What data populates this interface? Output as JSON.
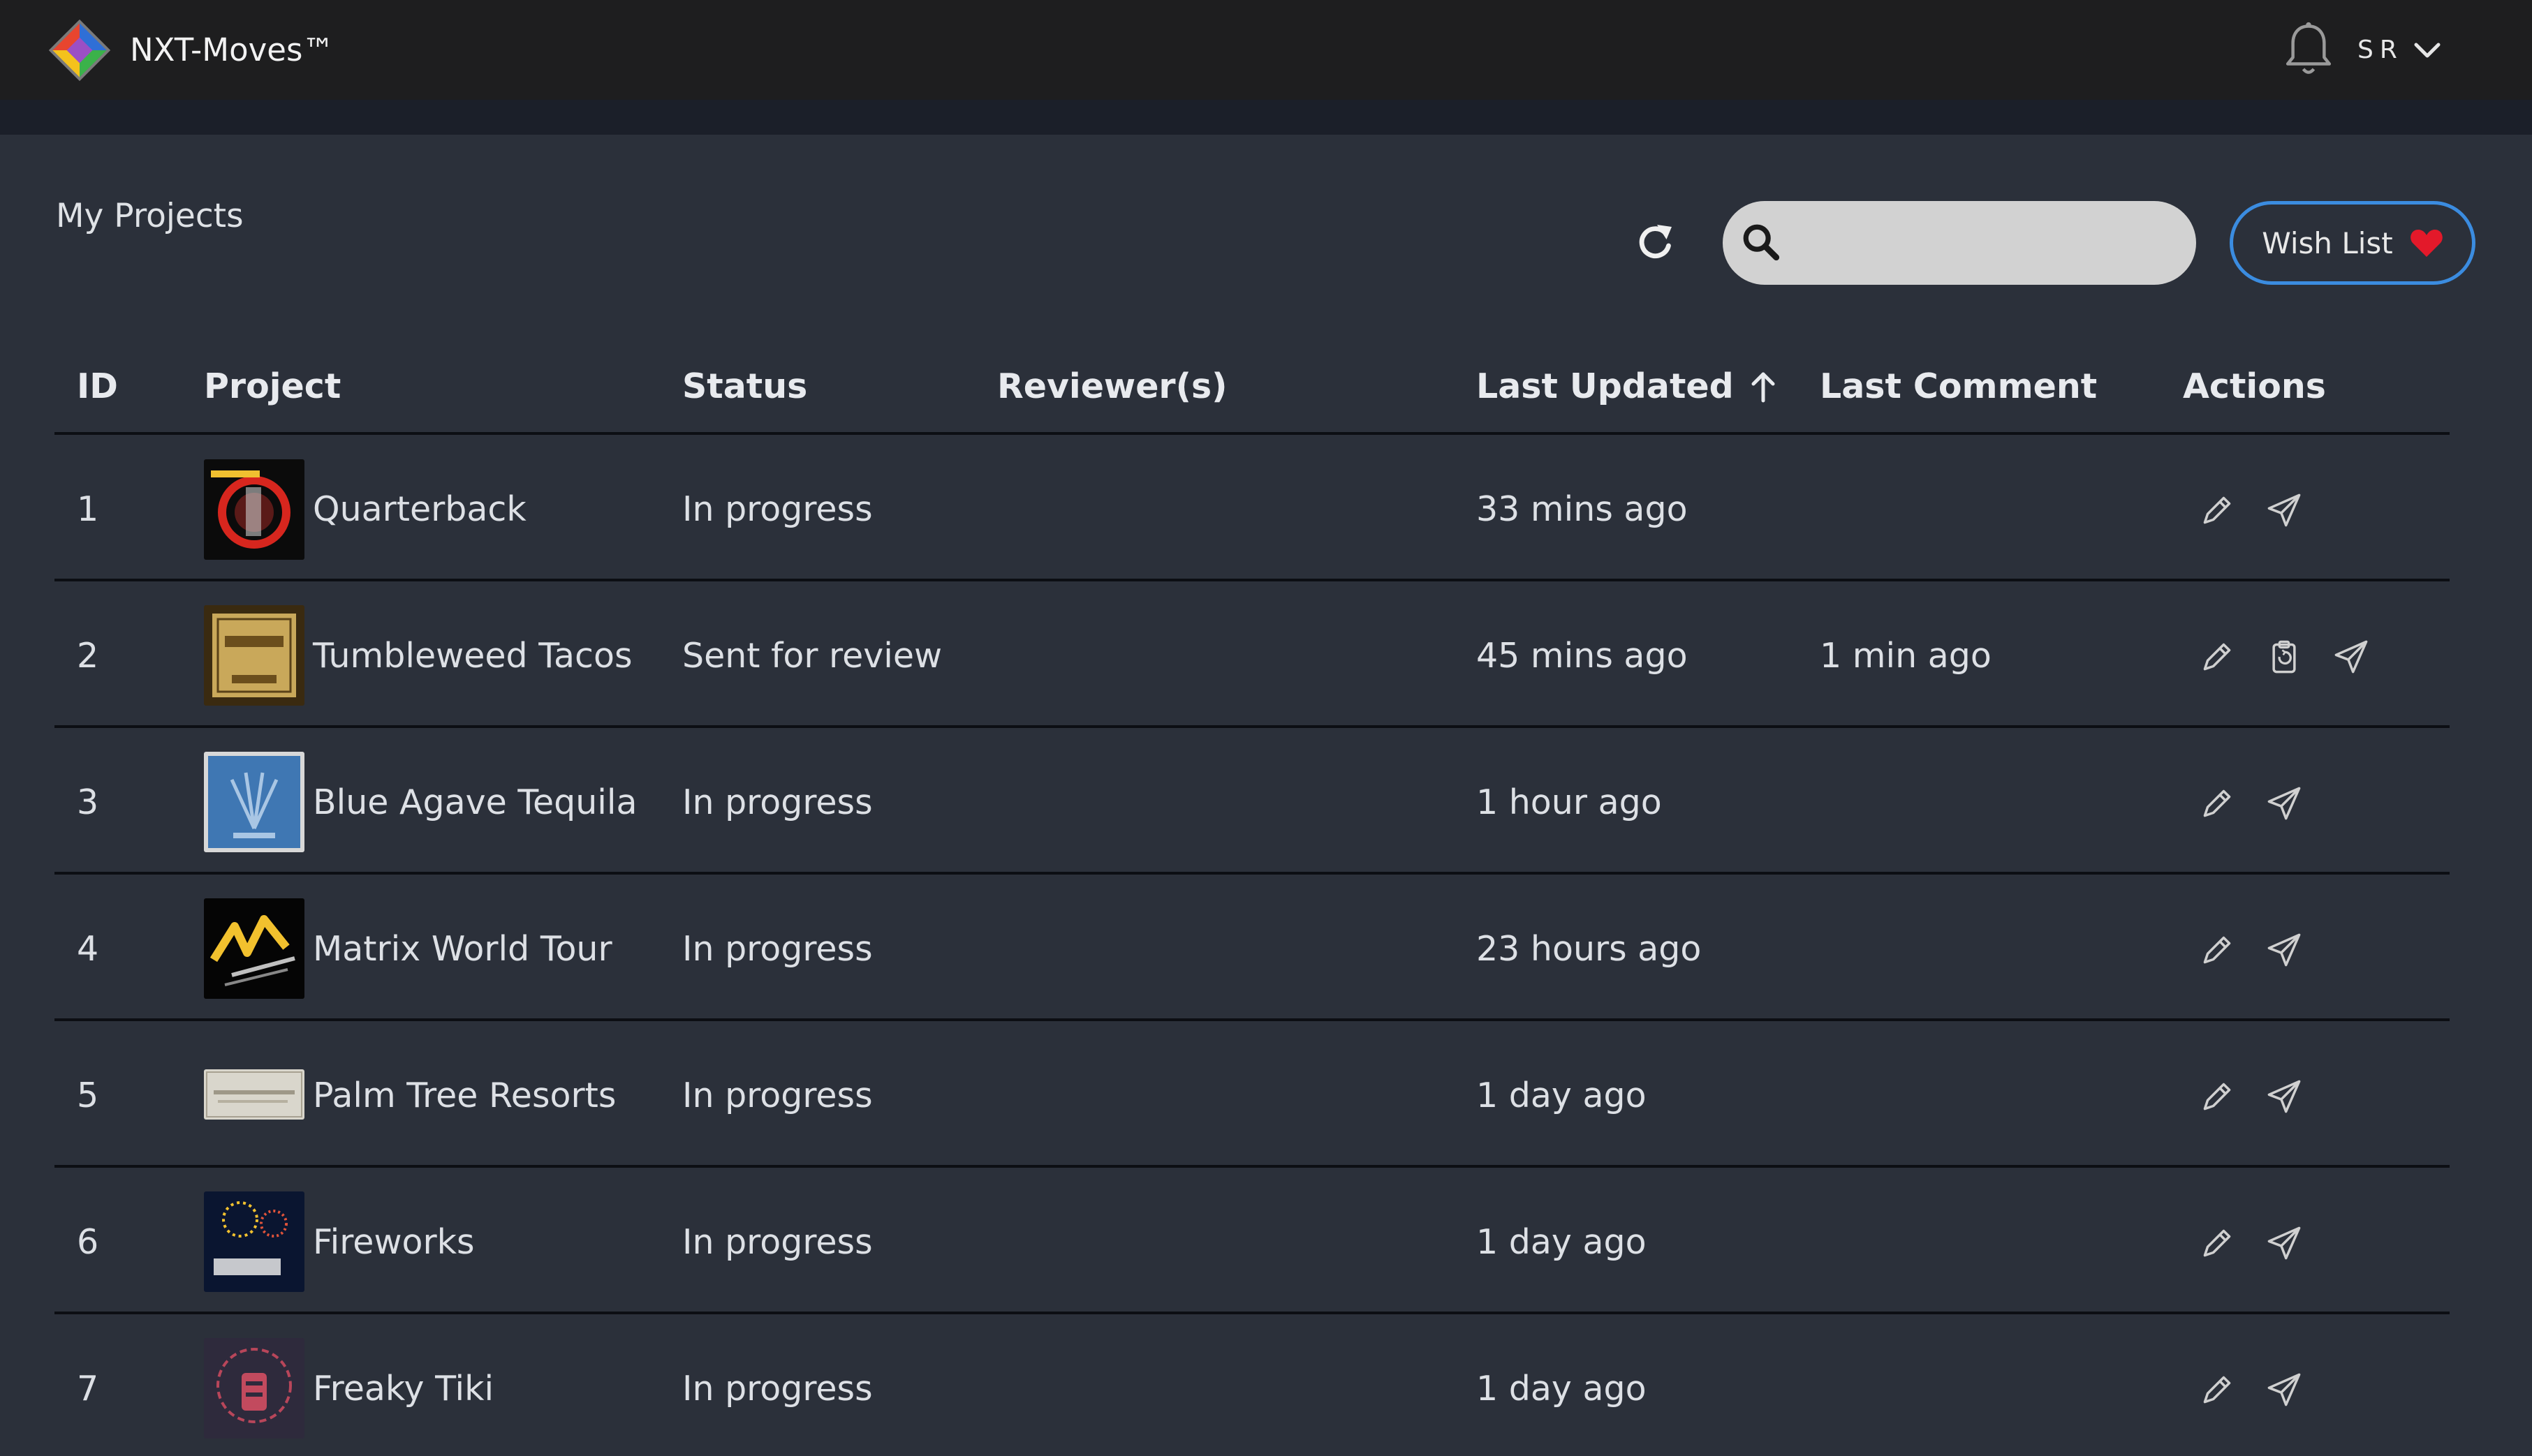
{
  "app": {
    "title": "NXT-Moves™",
    "user_initials": "SR"
  },
  "page": {
    "title": "My Projects"
  },
  "toolbar": {
    "search_placeholder": "",
    "search_value": "",
    "wishlist_label": "Wish List"
  },
  "columns": [
    "ID",
    "Project",
    "Status",
    "Reviewer(s)",
    "Last Updated",
    "Last Comment",
    "Actions"
  ],
  "sort": {
    "column": "Last Updated",
    "direction": "ascending"
  },
  "projects": [
    {
      "id": "1",
      "name": "Quarterback",
      "status": "In progress",
      "reviewers": "",
      "last_updated": "33 mins ago",
      "last_comment": "",
      "actions": [
        "edit-icon",
        "send-icon"
      ]
    },
    {
      "id": "2",
      "name": "Tumbleweed Tacos",
      "status": "Sent for review",
      "reviewers": "",
      "last_updated": "45 mins ago",
      "last_comment": "1 min ago",
      "actions": [
        "edit-icon",
        "review-clipboard-icon",
        "send-icon"
      ]
    },
    {
      "id": "3",
      "name": "Blue Agave Tequila",
      "status": "In progress",
      "reviewers": "",
      "last_updated": "1 hour ago",
      "last_comment": "",
      "actions": [
        "edit-icon",
        "send-icon"
      ]
    },
    {
      "id": "4",
      "name": "Matrix World Tour",
      "status": "In progress",
      "reviewers": "",
      "last_updated": "23 hours ago",
      "last_comment": "",
      "actions": [
        "edit-icon",
        "send-icon"
      ]
    },
    {
      "id": "5",
      "name": "Palm Tree Resorts",
      "status": "In progress",
      "reviewers": "",
      "last_updated": "1 day ago",
      "last_comment": "",
      "actions": [
        "edit-icon",
        "send-icon"
      ]
    },
    {
      "id": "6",
      "name": "Fireworks",
      "status": "In progress",
      "reviewers": "",
      "last_updated": "1 day ago",
      "last_comment": "",
      "actions": [
        "edit-icon",
        "send-icon"
      ]
    },
    {
      "id": "7",
      "name": "Freaky Tiki",
      "status": "In progress",
      "reviewers": "",
      "last_updated": "1 day ago",
      "last_comment": "",
      "actions": [
        "edit-icon",
        "send-icon"
      ]
    }
  ],
  "colors": {
    "topbar": "#1e1e1f",
    "background": "#2b303a",
    "wishlist_border": "#3b8ce0",
    "heart": "#e3192a",
    "search_bg": "#d2d2d2"
  },
  "icons": [
    "logo-icon",
    "bell-icon",
    "chevron-down-icon",
    "refresh-icon",
    "search-icon",
    "heart-icon",
    "arrow-up-icon",
    "edit-icon",
    "send-icon",
    "review-clipboard-icon"
  ]
}
